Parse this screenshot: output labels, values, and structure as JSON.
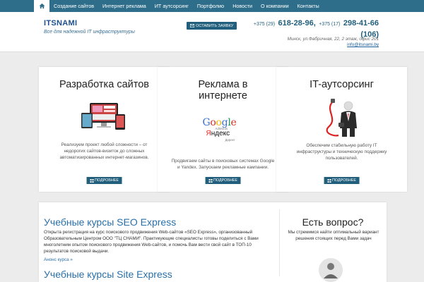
{
  "nav": {
    "items": [
      "Создание сайтов",
      "Интернет реклама",
      "ИТ аутсорсинг",
      "Портфолио",
      "Новости",
      "О компании",
      "Контакты"
    ]
  },
  "header": {
    "logo": "ITSNAMI",
    "tagline": "Все для надежной IT инфраструктуры",
    "order_button": "ОСТАВИТЬ ЗАЯВКУ",
    "phone1_prefix": "+375 (29)",
    "phone1_number": "618-28-96,",
    "phone2_prefix": "+375 (17)",
    "phone2_number": "298-41-66",
    "phone2_ext": "(106)",
    "address": "Минск, ул.Фабричная, 22, 2 этаж, офис 201",
    "email": "info@itsnami.by"
  },
  "cards": [
    {
      "title": "Разработка сайтов",
      "text": "Реализуем проект любой сложности – от недорогих сайтов-визиток до сложных автоматизированных интернет-магазинов.",
      "button": "ПОДРОБНЕЕ",
      "icon": "devices-icon"
    },
    {
      "title": "Реклама в интернете",
      "text": "Продвигаем сайты в поисковых системах Google и Yandex. Запускаем рекламные кампании.",
      "button": "ПОДРОБНЕЕ",
      "icon": "google-yandex-logo",
      "logo_text": {
        "google": "Google",
        "adwords": "AdWords",
        "yandex": "Яндекс",
        "direct": "Директ"
      }
    },
    {
      "title": "IT-аутсорсинг",
      "text": "Обеспечим стабильную работу IT инфраструктуры и техническую поддержку пользователей.",
      "button": "ПОДРОБНЕЕ",
      "icon": "businessman-cable-icon"
    }
  ],
  "courses": {
    "course1_title": "Учебные курсы SEO Express",
    "course1_text": "Открыта регистрация на курс поискового продвижения Web-сайтов «SEO Express», организованный Образовательным Центром ООО \"ТЦ СНАМИ\". Практикующие специалисты готовы поделиться с Вами многолетним опытом поискового продвижения Web-сайтов, и помочь Вам вести свой сайт в ТОП-10 результатов поисковой выдачи.",
    "course1_link": "Анонс курса »",
    "course2_title": "Учебные курсы Site Express"
  },
  "question": {
    "title": "Есть вопрос?",
    "text": "Мы стремимся найти оптимальный вариант решения стоящих перед Вами задач"
  },
  "colors": {
    "nav_bg": "#2f6e8a",
    "button_bg": "#215f7c",
    "link": "#2a6fa8",
    "page_bg": "#ececec"
  }
}
